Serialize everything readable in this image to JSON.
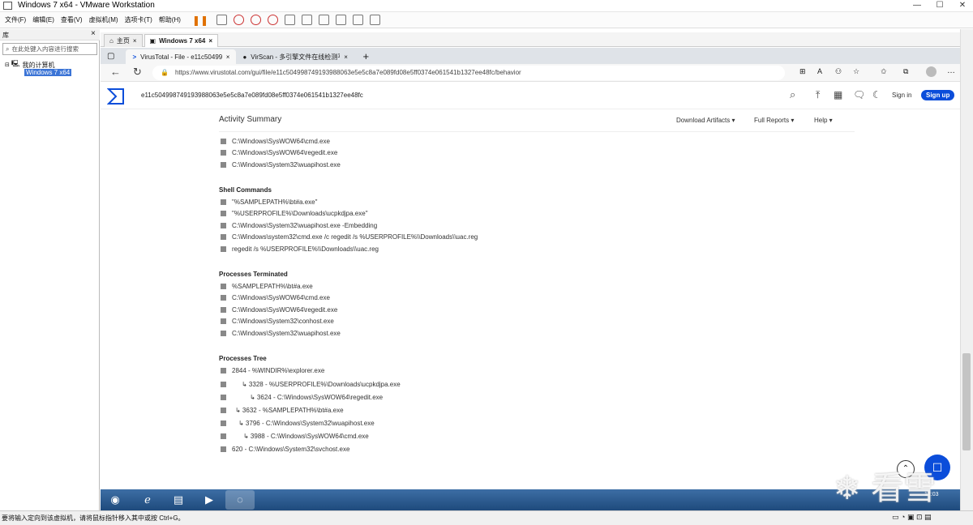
{
  "vmware": {
    "title": "Windows 7 x64 - VMware Workstation",
    "menus": [
      "文件(F)",
      "编辑(E)",
      "查看(V)",
      "虚拟机(M)",
      "选项卡(T)",
      "帮助(H)"
    ],
    "library_header": "库",
    "library_search_placeholder": "在此处键入内容进行搜索",
    "tree_root": "我的计算机",
    "tree_vm": "Windows 7 x64",
    "tabs": [
      "主页",
      "Windows 7 x64"
    ],
    "status_text": "要将输入定向到该虚拟机，请将鼠标指针移入其中或按 Ctrl+G。"
  },
  "edge": {
    "tabs": [
      "VirusTotal - File - e11c5049987",
      "VirScan - 多引擎文件在线检测平"
    ],
    "url": "https://www.virustotal.com/gui/file/e11c504998749193988063e5e5c8a7e089fd08e5ff0374e061541b1327ee48fc/behavior"
  },
  "vt": {
    "hash": "e11c504998749193988063e5e5c8a7e089fd08e5ff0374e061541b1327ee48fc",
    "sign_in": "Sign in",
    "sign_up": "Sign up",
    "activity_summary": "Activity Summary",
    "download_artifacts": "Download Artifacts",
    "full_reports": "Full Reports",
    "help": "Help",
    "top_entries": [
      "C:\\Windows\\SysWOW64\\cmd.exe",
      "C:\\Windows\\SysWOW64\\regedit.exe",
      "C:\\Windows\\System32\\wuapihost.exe"
    ],
    "shell_commands_title": "Shell Commands",
    "shell_commands": [
      "\"%SAMPLEPATH%\\bt#a.exe\"",
      "\"%USERPROFILE%\\Downloads\\ucpkdjpa.exe\"",
      "C:\\Windows\\System32\\wuapihost.exe -Embedding",
      "C:\\Windows\\system32\\cmd.exe /c regedit /s %USERPROFILE%\\\\Downloads\\\\uac.reg",
      "regedit /s %USERPROFILE%\\\\Downloads\\\\uac.reg"
    ],
    "terminated_title": "Processes Terminated",
    "terminated": [
      "%SAMPLEPATH%\\bt#a.exe",
      "C:\\Windows\\SysWOW64\\cmd.exe",
      "C:\\Windows\\SysWOW64\\regedit.exe",
      "C:\\Windows\\System32\\conhost.exe",
      "C:\\Windows\\System32\\wuapihost.exe"
    ],
    "tree_title": "Processes Tree",
    "tree": [
      "2844 - %WINDIR%\\explorer.exe",
      "↳ 3328 - %USERPROFILE%\\Downloads\\ucpkdjpa.exe",
      "↳ 3624 - C:\\Windows\\SysWOW64\\regedit.exe",
      "↳ 3632 - %SAMPLEPATH%\\bt#a.exe",
      "↳ 3796 - C:\\Windows\\System32\\wuapihost.exe",
      "↳ 3988 - C:\\Windows\\SysWOW64\\cmd.exe",
      "620 - C:\\Windows\\System32\\svchost.exe"
    ]
  },
  "taskbar": {
    "time": "17:03"
  },
  "watermark": "❄ 看雪",
  "colors": {
    "vt_blue": "#0b4dda",
    "taskbar": "#2a5a8f"
  }
}
